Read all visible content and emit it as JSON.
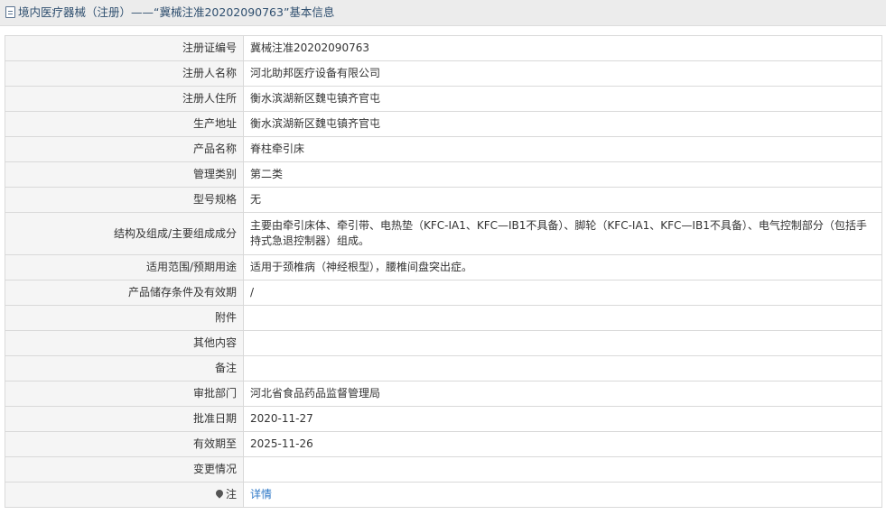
{
  "header": {
    "title": "境内医疗器械（注册）——“冀械注准20202090763”基本信息",
    "icon": "document-icon"
  },
  "rows": [
    {
      "label": "注册证编号",
      "value": "冀械注准20202090763"
    },
    {
      "label": "注册人名称",
      "value": "河北助邦医疗设备有限公司"
    },
    {
      "label": "注册人住所",
      "value": "衡水滨湖新区魏屯镇齐官屯"
    },
    {
      "label": "生产地址",
      "value": "衡水滨湖新区魏屯镇齐官屯"
    },
    {
      "label": "产品名称",
      "value": "脊柱牵引床"
    },
    {
      "label": "管理类别",
      "value": "第二类"
    },
    {
      "label": "型号规格",
      "value": "无"
    },
    {
      "label": "结构及组成/主要组成成分",
      "value": "主要由牵引床体、牵引带、电热垫（KFC-ⅠA1、KFC—ⅠB1不具备）、脚轮（KFC-ⅠA1、KFC—ⅠB1不具备）、电气控制部分（包括手持式急退控制器）组成。"
    },
    {
      "label": "适用范围/预期用途",
      "value": "适用于颈椎病（神经根型），腰椎间盘突出症。"
    },
    {
      "label": "产品储存条件及有效期",
      "value": "/"
    },
    {
      "label": "附件",
      "value": ""
    },
    {
      "label": "其他内容",
      "value": ""
    },
    {
      "label": "备注",
      "value": ""
    },
    {
      "label": "审批部门",
      "value": "河北省食品药品监督管理局"
    },
    {
      "label": "批准日期",
      "value": "2020-11-27"
    },
    {
      "label": "有效期至",
      "value": "2025-11-26"
    },
    {
      "label": "变更情况",
      "value": ""
    }
  ],
  "note_row": {
    "label": "注",
    "link": "详情",
    "icon": "pin-icon"
  },
  "colors": {
    "link": "#2e78c7",
    "label_bg": "#f5f5f5",
    "title_bg": "#ececec"
  }
}
